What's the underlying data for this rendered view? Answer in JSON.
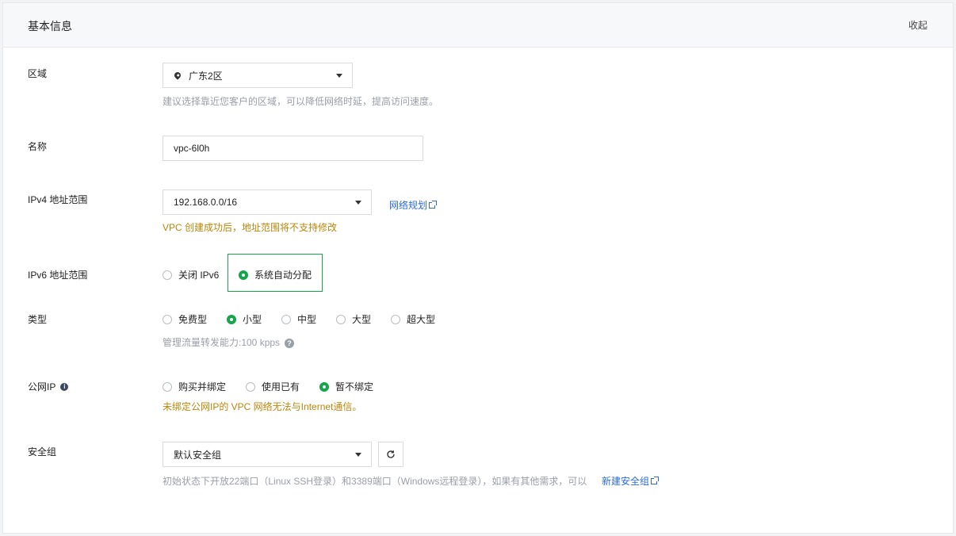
{
  "header": {
    "title": "基本信息",
    "collapse_label": "收起"
  },
  "region": {
    "label": "区域",
    "value": "广东2区",
    "hint": "建议选择靠近您客户的区域，可以降低网络时延，提高访问速度。"
  },
  "name": {
    "label": "名称",
    "value": "vpc-6l0h"
  },
  "ipv4": {
    "label": "IPv4 地址范围",
    "value": "192.168.0.0/16",
    "link": "网络规划",
    "warning": "VPC 创建成功后，地址范围将不支持修改"
  },
  "ipv6": {
    "label": "IPv6 地址范围",
    "options": [
      "关闭 IPv6",
      "系统自动分配"
    ],
    "selected": "系统自动分配"
  },
  "type": {
    "label": "类型",
    "options": [
      "免费型",
      "小型",
      "中型",
      "大型",
      "超大型"
    ],
    "selected": "小型",
    "hint": "管理流量转发能力:100 kpps"
  },
  "public_ip": {
    "label": "公网IP",
    "options": [
      "购买并绑定",
      "使用已有",
      "暂不绑定"
    ],
    "selected": "暂不绑定",
    "warning": "未绑定公网IP的 VPC 网络无法与Internet通信。"
  },
  "security_group": {
    "label": "安全组",
    "value": "默认安全组",
    "hint": "初始状态下开放22端口（Linux SSH登录）和3389端口（Windows远程登录），如果有其他需求，可以",
    "link": "新建安全组"
  },
  "colors": {
    "accent_green": "#15a54a",
    "link_blue": "#2c6bd6",
    "warning": "#b8860b"
  }
}
